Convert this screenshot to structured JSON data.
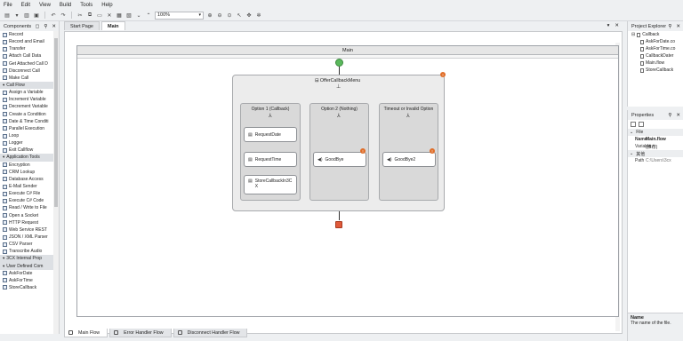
{
  "menu": [
    "File",
    "Edit",
    "View",
    "Build",
    "Tools",
    "Help"
  ],
  "toolbar": {
    "zoom": "100%"
  },
  "components": {
    "title": "Components",
    "items": [
      {
        "label": "Record",
        "cat": false
      },
      {
        "label": "Record and Email",
        "cat": false
      },
      {
        "label": "Transfer",
        "cat": false
      },
      {
        "label": "Attach Call Data",
        "cat": false
      },
      {
        "label": "Get Attached Call D",
        "cat": false
      },
      {
        "label": "Disconnect Call",
        "cat": false
      },
      {
        "label": "Make Call",
        "cat": false
      },
      {
        "label": "Call Flow",
        "cat": true
      },
      {
        "label": "Assign a Variable",
        "cat": false
      },
      {
        "label": "Increment Variable",
        "cat": false
      },
      {
        "label": "Decrement Variable",
        "cat": false
      },
      {
        "label": "Create a Condition",
        "cat": false
      },
      {
        "label": "Date & Time Conditi",
        "cat": false
      },
      {
        "label": "Parallel Execution",
        "cat": false
      },
      {
        "label": "Loop",
        "cat": false
      },
      {
        "label": "Logger",
        "cat": false
      },
      {
        "label": "Exit Callflow",
        "cat": false
      },
      {
        "label": "Application Tools",
        "cat": true
      },
      {
        "label": "Encryption",
        "cat": false
      },
      {
        "label": "CRM Lookup",
        "cat": false
      },
      {
        "label": "Database Access",
        "cat": false
      },
      {
        "label": "E-Mail Sender",
        "cat": false
      },
      {
        "label": "Execute C# File",
        "cat": false
      },
      {
        "label": "Execute C# Code",
        "cat": false
      },
      {
        "label": "Read / Write to File",
        "cat": false
      },
      {
        "label": "Open a Socket",
        "cat": false
      },
      {
        "label": "HTTP Request",
        "cat": false
      },
      {
        "label": "Web Service REST",
        "cat": false
      },
      {
        "label": "JSON / XML Parser",
        "cat": false
      },
      {
        "label": "CSV Parser",
        "cat": false
      },
      {
        "label": "Transcribe Audio",
        "cat": false
      },
      {
        "label": "3CX Internal Prop",
        "cat": true
      },
      {
        "label": "User Defined Com",
        "cat": true
      },
      {
        "label": "AskForDate",
        "cat": false
      },
      {
        "label": "AskForTime",
        "cat": false
      },
      {
        "label": "StoreCallback",
        "cat": false
      }
    ]
  },
  "doc_tabs": [
    "Start Page",
    "Main"
  ],
  "canvas": {
    "frame_title": "Main",
    "menu_title": "OfferCallbackMenu",
    "options": [
      {
        "title": "Option 1 (Callback)",
        "actions": [
          "RequestDate",
          "RequestTime",
          "StoreCallbackIn3CX"
        ]
      },
      {
        "title": "Option 2 (Nothing)",
        "actions": [
          "GoodBye"
        ]
      },
      {
        "title": "Timeout or Invalid Option",
        "actions": [
          "GoodBye2"
        ]
      }
    ]
  },
  "bottom_tabs": [
    "Main Flow",
    "Error Handler Flow",
    "Disconnect Handler Flow"
  ],
  "project_explorer": {
    "title": "Project Explorer",
    "items": [
      "Callback",
      "AskForDate.co",
      "AskForTime.co",
      "CallbackDater",
      "Main.flow",
      "StoreCallback"
    ]
  },
  "properties": {
    "title": "Properties",
    "group_file": "File",
    "rows": [
      {
        "k": "Name",
        "v": "Main.flow"
      },
      {
        "k": "Variable",
        "v": "(推荐)"
      }
    ],
    "group2": "其他",
    "rows2": [
      {
        "k": "Path",
        "v": "C:\\Users\\3cx"
      }
    ]
  },
  "description": {
    "title": "Name",
    "text": "The name of the file."
  }
}
